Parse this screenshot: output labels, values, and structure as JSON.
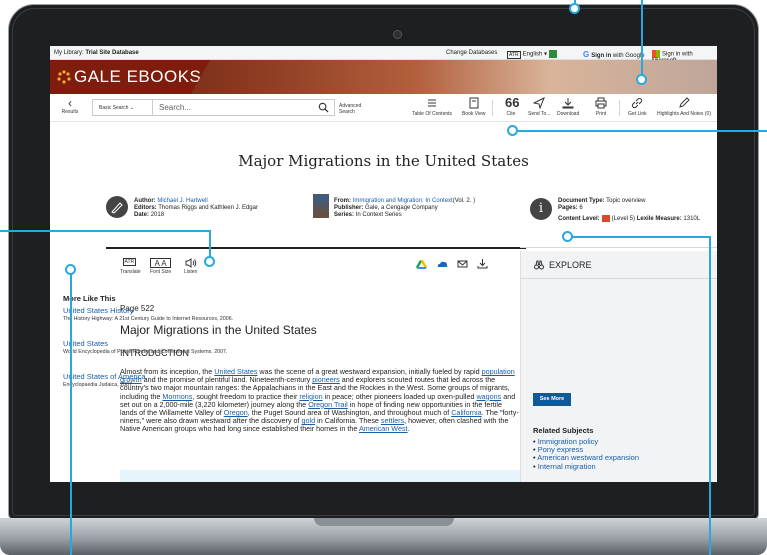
{
  "topbar": {
    "library_prefix": "My Library:",
    "library_name": "Trial Site Database",
    "change_db": "Change Databases",
    "atr": "ATR",
    "language": "English",
    "google_prefix": "Sign in",
    "google_with": "with Google",
    "microsoft": "Sign in with Microsoft"
  },
  "banner": {
    "brand": "GALE EBOOKS"
  },
  "toolbar": {
    "back_label": "Results",
    "search_type": "Basic Search",
    "search_placeholder": "Search...",
    "advanced_1": "Advanced",
    "advanced_2": "Search",
    "tools": [
      "Table Of Contents",
      "Book View",
      "Cite",
      "Send To...",
      "Download",
      "Print",
      "Get Link",
      "Highlights And Notes (0)"
    ]
  },
  "document": {
    "title": "Major Migrations in the United States",
    "author_label": "Author:",
    "author": "Michael J. Hartwell",
    "editors_label": "Editors:",
    "editors": "Thomas Riggs and Kathleen J. Edgar",
    "date_label": "Date:",
    "date": "2018",
    "from_label": "From:",
    "from": "Immigration and Migration: In Context",
    "volume": "(Vol. 2. )",
    "publisher_label": "Publisher:",
    "publisher": "Gale, a Cengage Company",
    "series_label": "Series:",
    "series": "In Context Series",
    "doctype_label": "Document Type:",
    "doctype": "Topic overview",
    "pages_label": "Pages:",
    "pages": "6",
    "content_level_label": "Content Level:",
    "content_level": "(Level 5)",
    "lexile_label": "Lexile Measure:",
    "lexile": "1310L"
  },
  "reading_tools": {
    "translate": "Translate",
    "font_size": "Font Size",
    "listen": "Listen",
    "atr": "ATR",
    "font_glyph": "A A"
  },
  "article": {
    "page": "Page 522",
    "title": "Major Migrations in the United States",
    "section": "INTRODUCTION",
    "s1": "Almost from its inception, the ",
    "l1": "United States",
    "s2": " was the scene of a great westward expansion, initially fueled by rapid ",
    "l2": "population growth",
    "s3": " and the promise of plentiful land. Nineteenth-century ",
    "l3": "pioneers",
    "s4": " and explorers scouted routes that led across the country's two major mountain ranges: the Appalachians in the East and the Rockies in the West. Some groups of migrants, including the ",
    "l4": "Mormons",
    "s5": ", sought freedom to practice their ",
    "l5": "religion",
    "s6": " in peace; other pioneers loaded up oxen-pulled ",
    "l6": "wagons",
    "s7": " and set out on a 2,000-mile (3,220 kilometer) journey along the ",
    "l7": "Oregon Trail",
    "s8": " in hope of finding new opportunities in the fertile lands of the Willamette Valley of ",
    "l8": "Oregon",
    "s9": ", the Puget Sound area of Washington, and throughout much of ",
    "l9": "California",
    "s10": ". The \"forty-niners,\" were also drawn westward after the discovery of ",
    "l10": "gold",
    "s11": " in California. These ",
    "l11": "settlers",
    "s12": ", however, often clashed with the Native American groups who had long since established their homes in the ",
    "l12": "American West",
    "s13": "."
  },
  "explore": {
    "heading": "EXPLORE",
    "more_like_this": "More Like This",
    "items": [
      {
        "title": "United States History",
        "desc": "The History Highway: A 21st Century Guide to Internet Resources, 2006."
      },
      {
        "title": "United States",
        "desc": "World Encyclopedia of Police Forces and Correctional Systems, 2007."
      },
      {
        "title": "United States of America",
        "desc": "Encyclopaedia Judaica, 2007."
      }
    ],
    "see_more": "See More",
    "related_subjects": "Related Subjects",
    "subjects": [
      "Immigration policy",
      "Pony express",
      "American westward expansion",
      "Internal migration"
    ]
  },
  "colors": {
    "accent_blue": "#1a5ea8",
    "callout": "#29a8e0",
    "brand_red": "#7e1d0d",
    "button_blue": "#0e5a99"
  }
}
